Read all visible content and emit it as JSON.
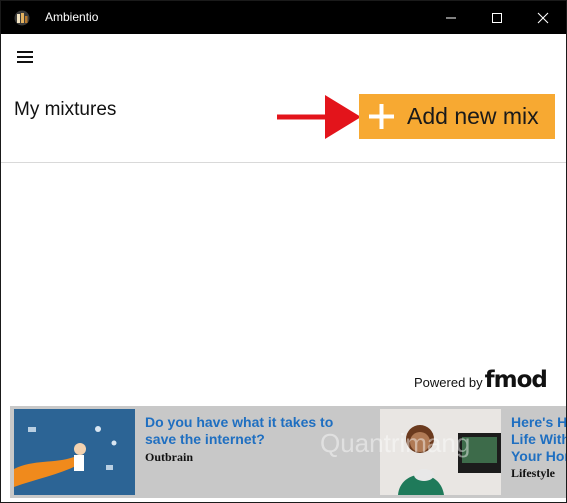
{
  "window": {
    "title": "Ambientio",
    "controls": [
      "minimize-icon",
      "maximize-icon",
      "close-icon"
    ]
  },
  "nav": {
    "menu_icon": "hamburger-menu-icon"
  },
  "main": {
    "heading": "My mixtures",
    "add_button_label": "Add new mix",
    "add_button_icon": "plus-icon",
    "annotation": "red-arrow-icon"
  },
  "footer": {
    "powered_by": "Powered by",
    "logo_text": "fmod"
  },
  "ads": [
    {
      "title": "Do you have what it takes to save the internet?",
      "source": "Outbrain"
    },
    {
      "title": "Here's H\nLife With\nYour Hon",
      "source": "Lifestyle"
    }
  ],
  "watermark": {
    "text": "Quantrimang"
  },
  "colors": {
    "titlebar": "#000000",
    "accent": "#f7a932",
    "arrow": "#e3141b",
    "ad_link": "#1f6fc1",
    "ad_background": "#c8c8c8"
  }
}
